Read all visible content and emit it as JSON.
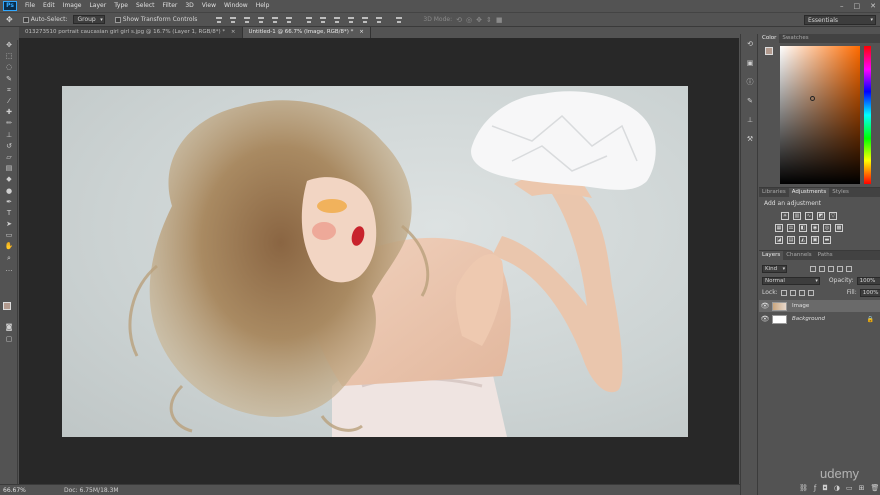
{
  "app": {
    "logo": "Ps"
  },
  "menubar": {
    "items": [
      "File",
      "Edit",
      "Image",
      "Layer",
      "Type",
      "Select",
      "Filter",
      "3D",
      "View",
      "Window",
      "Help"
    ],
    "win_min": "–",
    "win_max": "□",
    "win_close": "✕"
  },
  "options": {
    "auto_select_label": "Auto-Select:",
    "auto_select_value": "Group",
    "transform_label": "Show Transform Controls",
    "mode_3d_label": "3D Mode:",
    "workspace": "Essentials"
  },
  "tabs": [
    {
      "label": "013273510 portrait caucasian girl girl s.jpg @ 16.7% (Layer 1, RGB/8*) *",
      "close": "×"
    },
    {
      "label": "Untitled-1 @ 66.7% (Image, RGB/8*) *",
      "close": "×"
    }
  ],
  "status": {
    "zoom": "66.67%",
    "doc": "Doc: 6.75M/18.3M"
  },
  "panels": {
    "color_tabs": [
      "Color",
      "Swatches"
    ],
    "adj_tabs": [
      "Libraries",
      "Adjustments",
      "Styles"
    ],
    "adj_title": "Add an adjustment",
    "layers_tabs": [
      "Layers",
      "Channels",
      "Paths"
    ],
    "kind": "Kind",
    "blend_mode": "Normal",
    "opacity_label": "Opacity:",
    "opacity_value": "100%",
    "lock_label": "Lock:",
    "fill_label": "Fill:",
    "fill_value": "100%",
    "layers": [
      {
        "name": "Image",
        "selected": true
      },
      {
        "name": "Background",
        "selected": false
      }
    ]
  },
  "watermark": "udemy",
  "colors": {
    "foreground": "#b29a8e",
    "background": "#111111",
    "accent": "#31a8ff"
  }
}
